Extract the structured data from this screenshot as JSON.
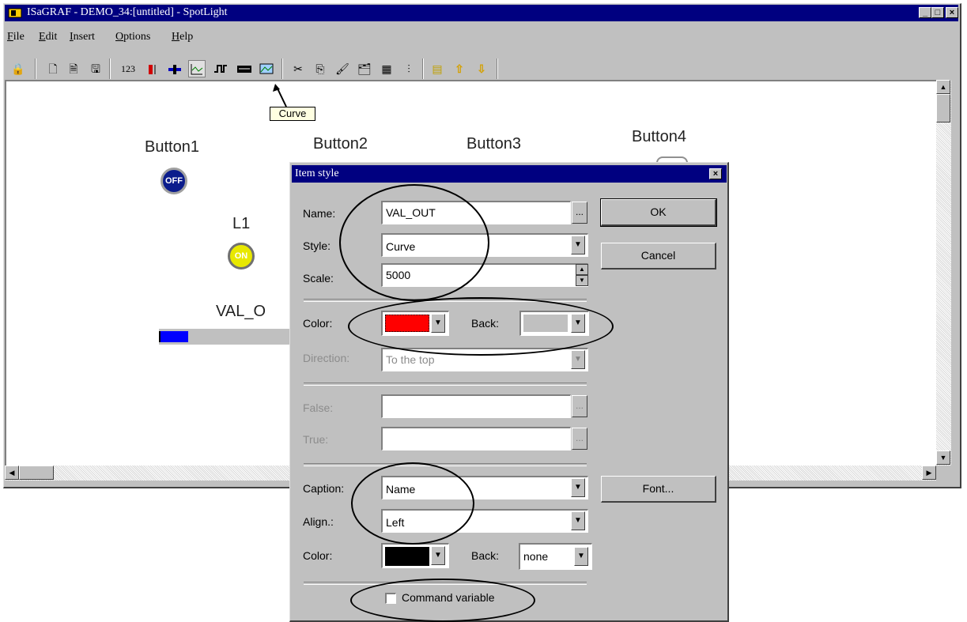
{
  "window": {
    "title": "ISaGRAF - DEMO_34:[untitled] - SpotLight",
    "minimize": "_",
    "maximize": "□",
    "close": "×"
  },
  "menu": [
    {
      "label": "File",
      "mnemonic": "F"
    },
    {
      "label": "Edit",
      "mnemonic": "E"
    },
    {
      "label": "Insert",
      "mnemonic": "I"
    },
    {
      "label": "Options",
      "mnemonic": "O"
    },
    {
      "label": "Help",
      "mnemonic": "H"
    }
  ],
  "toolbar": {
    "numeric_label": "123",
    "tooltip": "Curve"
  },
  "canvas": {
    "button1_label": "Button1",
    "button2_label": "Button2",
    "button3_label": "Button3",
    "button4_label": "Button4",
    "button1_state": "OFF",
    "lamp_label": "L1",
    "lamp_state": "ON",
    "bar_label": "VAL_O"
  },
  "dialog": {
    "title": "Item style",
    "close": "×",
    "name_label": "Name:",
    "name_value": "VAL_OUT",
    "style_label": "Style:",
    "style_value": "Curve",
    "scale_label": "Scale:",
    "scale_value": "5000",
    "color_label": "Color:",
    "color_value": "#ff0000",
    "back_label": "Back:",
    "back_value": "#c0c0c0",
    "direction_label": "Direction:",
    "direction_value": "To the top",
    "false_label": "False:",
    "true_label": "True:",
    "caption_label": "Caption:",
    "caption_value": "Name",
    "align_label": "Align.:",
    "align_value": "Left",
    "caption_color_label": "Color:",
    "caption_color_value": "#000000",
    "caption_back_label": "Back:",
    "caption_back_value": "none",
    "command_variable_label": "Command variable",
    "command_variable_checked": false,
    "ok_label": "OK",
    "cancel_label": "Cancel",
    "font_label": "Font...",
    "ellipsis": "..."
  }
}
